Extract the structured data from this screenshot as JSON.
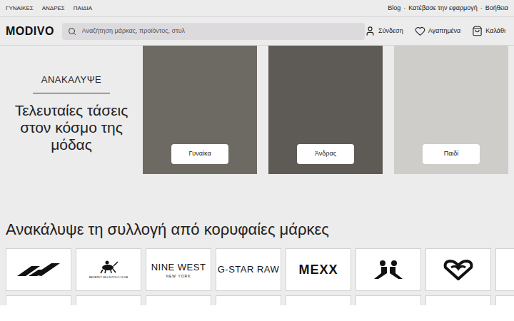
{
  "top_bar": {
    "links": [
      "ΓΥΝΑΙΚΕΣ",
      "ΑΝΔΡΕΣ",
      "ΠΑΙΔΙΑ"
    ],
    "right_links": [
      "Blog",
      "Κατέβασε την εφαρμογή",
      "Βοήθεια"
    ],
    "separator": "·"
  },
  "header": {
    "logo": "MODIVO",
    "search": {
      "placeholder": "Αναζήτηση μάρκας, προϊόντος, στυλ"
    },
    "actions": [
      {
        "label": "Σύνδεση",
        "kind": "user"
      },
      {
        "label": "Αγαπημένα",
        "kind": "heart"
      },
      {
        "label": "Καλάθι",
        "kind": "bag"
      }
    ]
  },
  "hero": {
    "eyebrow": "ΑΝΑΚΑΛΥΨΕ",
    "title": "Τελευταίες τάσεις στον κόσμο της μόδας",
    "categories": [
      {
        "label": "Γυναίκα",
        "color": "#6d6a64"
      },
      {
        "label": "Άνδρας",
        "color": "#5e5b56"
      },
      {
        "label": "Παιδί",
        "color": "#cfcdc9"
      }
    ]
  },
  "brands": {
    "title": "Ανακάλυψε τη συλλογή από κορυφαίες μάρκες",
    "items": [
      {
        "kind": "reebok"
      },
      {
        "kind": "emblem",
        "text": "BEVERLY HILLS POLO CLUB"
      },
      {
        "kind": "text",
        "text": "NINE WEST",
        "sub": "NEW YORK"
      },
      {
        "kind": "text",
        "text": "G-STAR RAW"
      },
      {
        "kind": "text",
        "text": "MEXX"
      },
      {
        "kind": "kappa"
      },
      {
        "kind": "roxy"
      },
      {
        "kind": "partial"
      }
    ]
  }
}
